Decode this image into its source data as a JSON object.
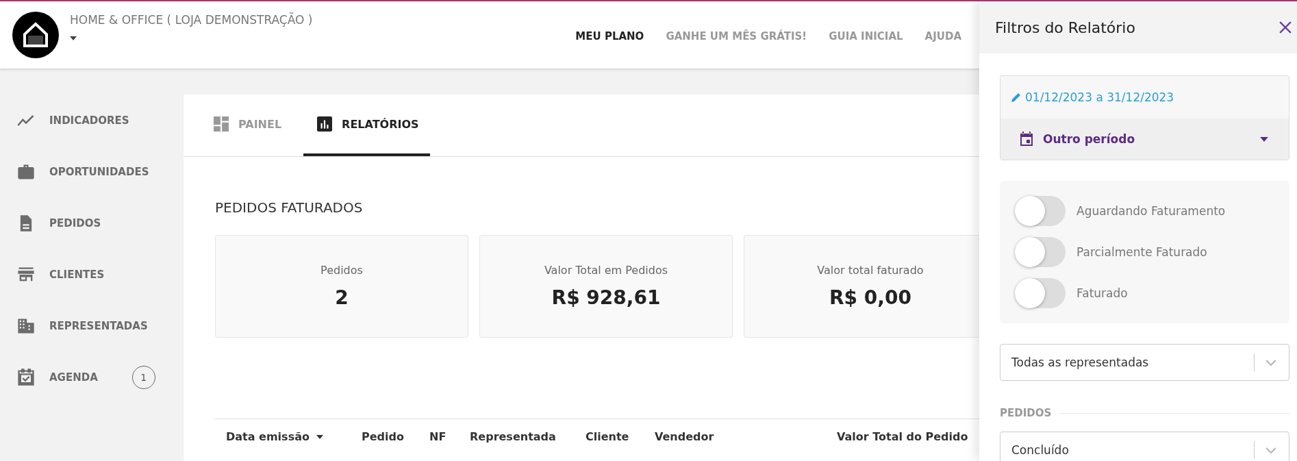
{
  "header": {
    "store_name": "HOME & OFFICE ( LOJA DEMONSTRAÇÃO )",
    "nav": [
      {
        "label": "MEU PLANO",
        "selected": true
      },
      {
        "label": "GANHE UM MÊS GRÁTIS!",
        "selected": false
      },
      {
        "label": "GUIA INICIAL",
        "selected": false
      },
      {
        "label": "AJUDA",
        "selected": false
      }
    ]
  },
  "sidebar": {
    "items": [
      {
        "label": "INDICADORES"
      },
      {
        "label": "OPORTUNIDADES"
      },
      {
        "label": "PEDIDOS"
      },
      {
        "label": "CLIENTES"
      },
      {
        "label": "REPRESENTADAS"
      },
      {
        "label": "AGENDA",
        "badge": "1"
      }
    ]
  },
  "tabs": [
    {
      "label": "PAINEL",
      "selected": false
    },
    {
      "label": "RELATÓRIOS",
      "selected": true
    }
  ],
  "report": {
    "title": "PEDIDOS FATURADOS",
    "stats": [
      {
        "label": "Pedidos",
        "value": "2"
      },
      {
        "label": "Valor Total em Pedidos",
        "value": "R$ 928,61"
      },
      {
        "label": "Valor total faturado",
        "value": "R$ 0,00"
      }
    ],
    "table": {
      "columns": [
        {
          "label": "Data emissão",
          "sorted": true
        },
        {
          "label": "Pedido",
          "sorted": false
        },
        {
          "label": "NF",
          "sorted": false
        },
        {
          "label": "Representada",
          "sorted": false
        },
        {
          "label": "Cliente",
          "sorted": false
        },
        {
          "label": "Vendedor",
          "sorted": false
        },
        {
          "label": "Valor Total do Pedido",
          "sorted": false
        }
      ]
    }
  },
  "filters": {
    "title": "Filtros do Relatório",
    "date_range": "01/12/2023 a 31/12/2023",
    "period": "Outro período",
    "status_toggles": [
      {
        "label": "Aguardando Faturamento",
        "on": false
      },
      {
        "label": "Parcialmente Faturado",
        "on": false
      },
      {
        "label": "Faturado",
        "on": false
      }
    ],
    "represented_select": {
      "value": "Todas as representadas"
    },
    "orders_section": "PEDIDOS",
    "orders_select": {
      "value": "Concluído"
    }
  }
}
